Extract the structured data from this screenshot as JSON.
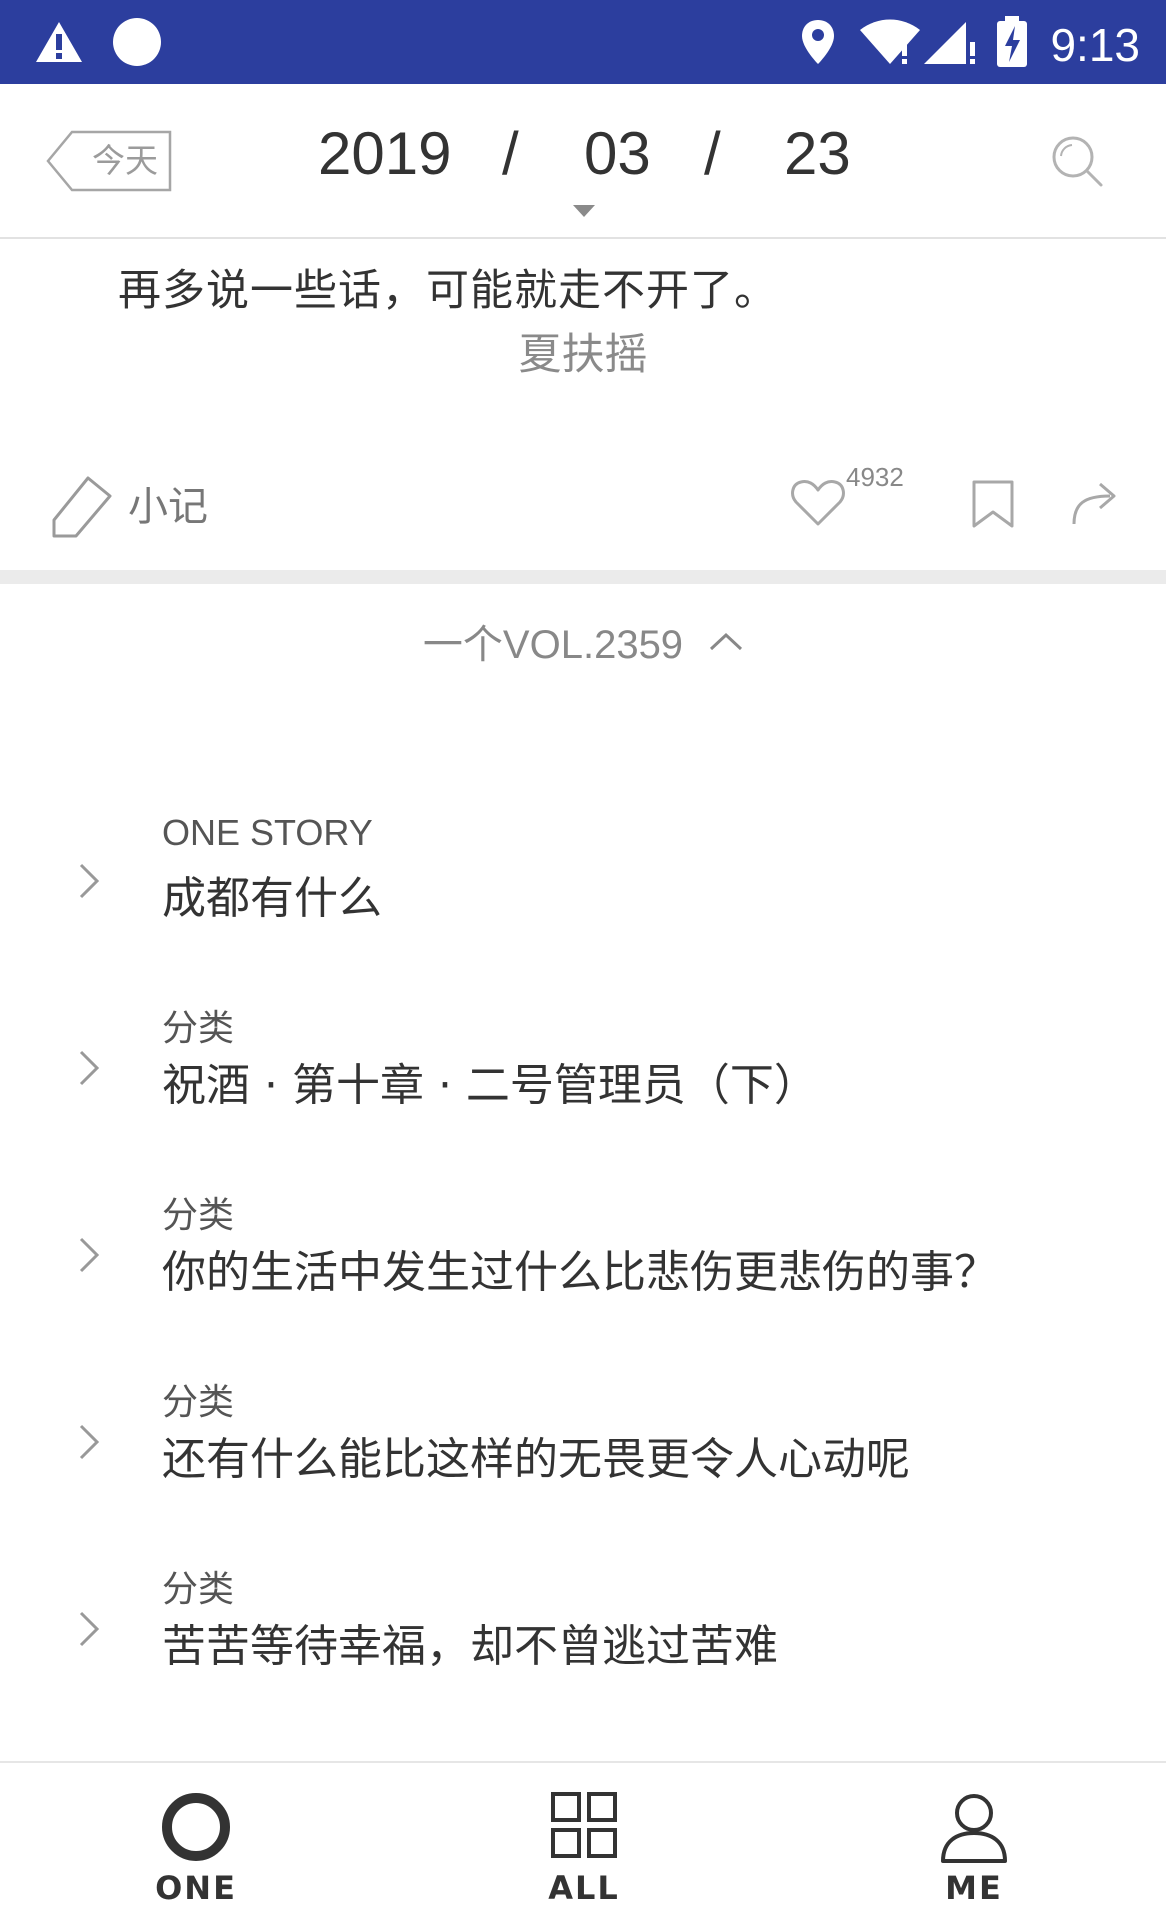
{
  "status_bar": {
    "time": "9:13",
    "icons": [
      "alert-icon",
      "circle-icon",
      "location-icon",
      "wifi-icon",
      "signal-icon",
      "battery-charging-icon"
    ],
    "background": "#2c3e9e"
  },
  "header": {
    "today_label": "今天",
    "year": "2019",
    "month": "03",
    "day": "23",
    "separator": "/"
  },
  "quote": {
    "text": "再多说一些话，可能就走不开了。",
    "author": "夏扶摇"
  },
  "actions": {
    "note_label": "小记",
    "like_count": "4932"
  },
  "volume": {
    "label": "一个VOL.2359"
  },
  "list": [
    {
      "category": "ONE STORY",
      "title": "成都有什么"
    },
    {
      "category": "分类",
      "title": "祝酒 · 第十章 · 二号管理员（下）"
    },
    {
      "category": "分类",
      "title": "你的生活中发生过什么比悲伤更悲伤的事？"
    },
    {
      "category": "分类",
      "title": "还有什么能比这样的无畏更令人心动呢"
    },
    {
      "category": "分类",
      "title": "苦苦等待幸福，却不曾逃过苦难"
    }
  ],
  "bottom_nav": [
    {
      "label": "ONE",
      "icon": "ring-icon"
    },
    {
      "label": "ALL",
      "icon": "grid-icon"
    },
    {
      "label": "ME",
      "icon": "person-icon"
    }
  ]
}
